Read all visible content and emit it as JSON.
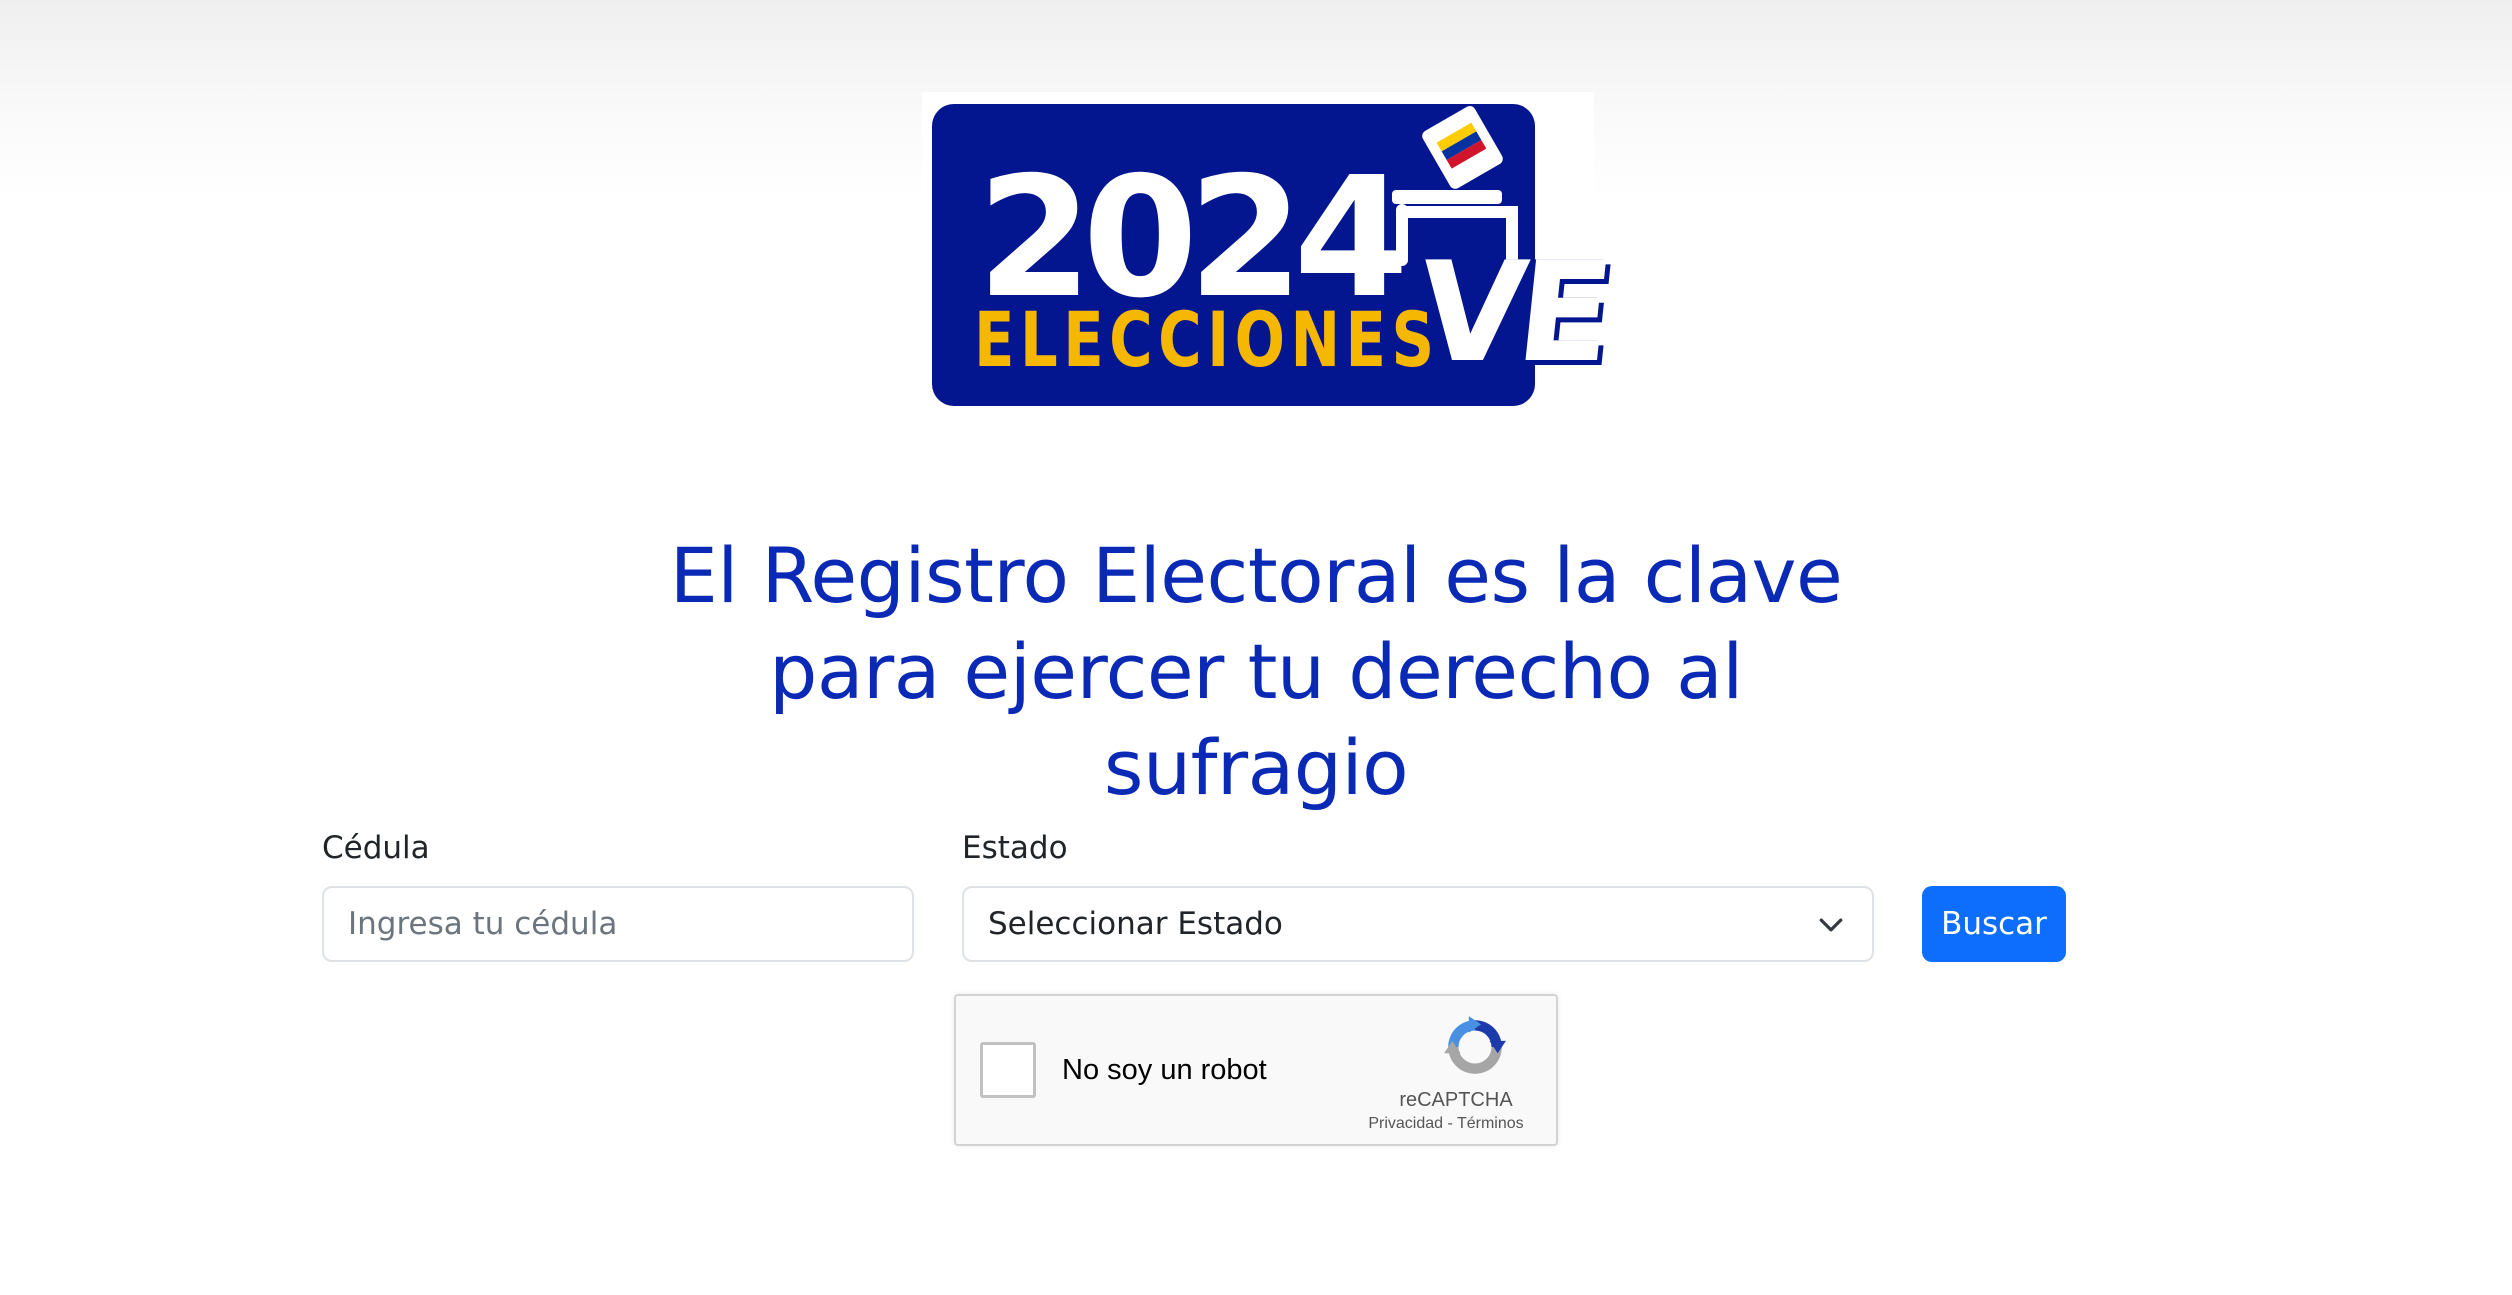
{
  "logo": {
    "year": "2024",
    "word": "ELECCIONES",
    "country": "VE",
    "colors": {
      "panel": "#04168f",
      "year": "#ffffff",
      "word": "#f5b700",
      "flag_yellow": "#ffcc00",
      "flag_blue": "#0033a0",
      "flag_red": "#cf142b"
    }
  },
  "headline": "El Registro Electoral es la clave para ejercer tu derecho al sufragio",
  "form": {
    "cedula": {
      "label": "Cédula",
      "placeholder": "Ingresa tu cédula",
      "value": ""
    },
    "estado": {
      "label": "Estado",
      "selected": "Seleccionar Estado",
      "icon": "chevron-down-icon"
    },
    "submit_label": "Buscar"
  },
  "recaptcha": {
    "label": "No soy un robot",
    "brand": "reCAPTCHA",
    "privacy": "Privacidad",
    "separator": "-",
    "terms": "Términos",
    "icon": "recaptcha-logo-icon"
  },
  "colors": {
    "headline": "#0a2ab5",
    "primary_button": "#0d6efd",
    "input_border": "#dee2e6"
  }
}
